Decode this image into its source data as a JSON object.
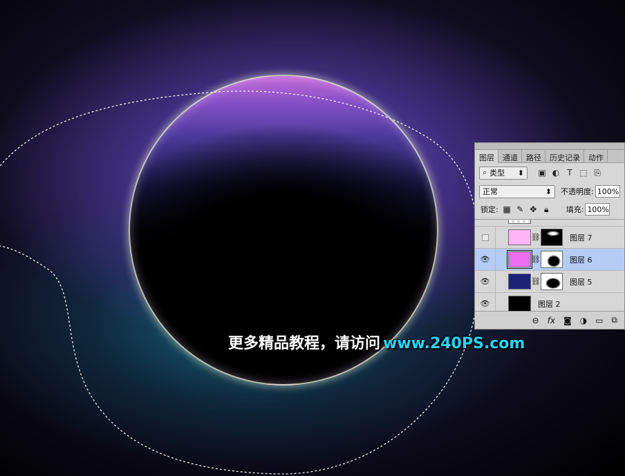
{
  "layers_panel": {
    "tabs": [
      "图层",
      "通道",
      "路径",
      "历史记录",
      "动作"
    ],
    "active_tab": "图层",
    "filter": {
      "icon": "search-icon",
      "label": "类型"
    },
    "filter_icons": [
      "image-filter-icon",
      "adjustment-filter-icon",
      "type-filter-icon",
      "shape-filter-icon",
      "smart-object-filter-icon"
    ],
    "blend_mode": "正常",
    "opacity_label": "不透明度:",
    "opacity_value": "100%",
    "lock_label": "锁定:",
    "fill_label": "填充:",
    "fill_value": "100%",
    "layers": [
      {
        "name": "图层 7",
        "visible": false,
        "selected": false,
        "fill_color": "#ffb6f7",
        "has_mask": true
      },
      {
        "name": "图层 6",
        "visible": true,
        "selected": true,
        "fill_color": "#ef6ef0",
        "has_mask": true
      },
      {
        "name": "图层 5",
        "visible": true,
        "selected": false,
        "fill_color": "#1e237a",
        "has_mask": true
      },
      {
        "name": "图层 2",
        "visible": true,
        "selected": false,
        "fill_color": "#000000",
        "has_mask": false
      }
    ],
    "footer_icons": [
      "link-icon",
      "fx-icon",
      "mask-icon",
      "adjustment-icon",
      "group-folder-icon",
      "new-layer-icon"
    ]
  },
  "watermark": {
    "text": "更多精品教程，请访问",
    "url": "www.240PS.com",
    "url_color": "#29d4ff"
  },
  "colors": {
    "selected_layer": "#b5cdf5",
    "panel_bg": "#d7d7d7"
  }
}
